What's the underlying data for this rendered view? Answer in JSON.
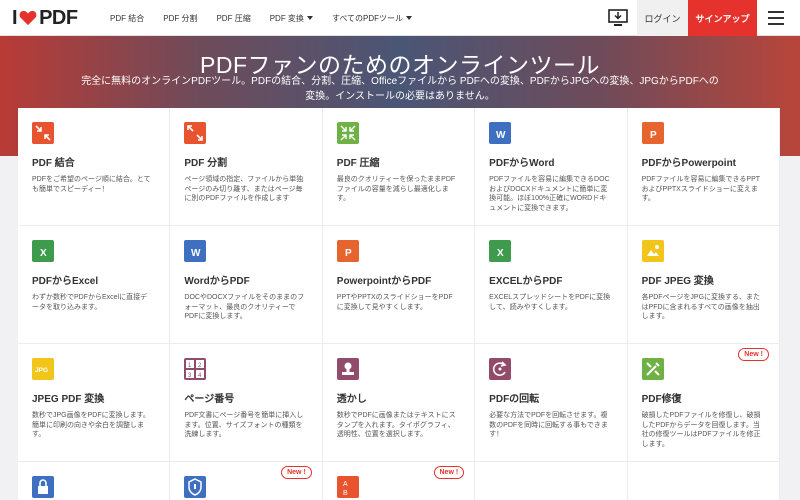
{
  "header": {
    "logo_left": "I",
    "logo_right": "PDF",
    "nav": [
      {
        "label": "PDF 結合"
      },
      {
        "label": "PDF 分割"
      },
      {
        "label": "PDF 圧縮"
      },
      {
        "label": "PDF 変換",
        "dropdown": true
      },
      {
        "label": "すべてのPDFツール",
        "dropdown": true
      }
    ],
    "login": "ログイン",
    "signup": "サインアップ"
  },
  "hero": {
    "title": "PDFファンのためのオンラインツール",
    "subtitle": "完全に無料のオンラインPDFツール。PDFの結合、分割、圧縮、Officeファイルから PDFへの変換、PDFからJPGへの変換、JPGからPDFへの変換。インストールの必要はありません。"
  },
  "tools": [
    {
      "title": "PDF 結合",
      "desc": "PDFをご希望のページ順に結合。とても簡単でスピーディー！",
      "icon": "merge-icon",
      "color": "#e8542f"
    },
    {
      "title": "PDF 分割",
      "desc": "ページ領域の指定、ファイルから単独ページのみ切り離す、またはページ毎に別のPDFファイルを作成します",
      "icon": "split-icon",
      "color": "#e8542f"
    },
    {
      "title": "PDF 圧縮",
      "desc": "最良のクオリティーを保ったままPDFファイルの容量を減らし最適化します。",
      "icon": "compress-icon",
      "color": "#6fb145"
    },
    {
      "title": "PDFからWord",
      "desc": "PDFファイルを容易に編集できるDOCおよびDOCXドキュメントに簡単に変換可能。ほぼ100%正確にWORDドキュメントに変換できます。",
      "icon": "word-icon",
      "color": "#3f6fc0"
    },
    {
      "title": "PDFからPowerpoint",
      "desc": "PDFファイルを容易に編集できるPPTおよびPPTXスライドショーに変えます。",
      "icon": "powerpoint-icon",
      "color": "#e8642f"
    },
    {
      "title": "PDFからExcel",
      "desc": "わずか数秒でPDFからExcelに直接データを取り込みます。",
      "icon": "excel-icon",
      "color": "#3e9a4d"
    },
    {
      "title": "WordからPDF",
      "desc": "DOCやDOCXファイルをそのままのフォーマット、最良のクオリティーでPDFに変換します。",
      "icon": "word-to-pdf-icon",
      "color": "#3f6fc0"
    },
    {
      "title": "PowerpointからPDF",
      "desc": "PPTやPPTXのスライドショーをPDFに変換して見やすくします。",
      "icon": "powerpoint-to-pdf-icon",
      "color": "#e8642f"
    },
    {
      "title": "EXCELからPDF",
      "desc": "EXCELスプレッドシートをPDFに変換して、読みやすくします。",
      "icon": "excel-to-pdf-icon",
      "color": "#3e9a4d"
    },
    {
      "title": "PDF JPEG 変換",
      "desc": "各PDFページをJPGに変換する、またはPFDに含まれるすべての画像を抽出します。",
      "icon": "pdf-to-jpg-icon",
      "color": "#f2c51a"
    },
    {
      "title": "JPEG PDF 変換",
      "desc": "数秒でJPG画像をPDFに変換します。簡単に印刷の向きや余白を調整します。",
      "icon": "jpg-to-pdf-icon",
      "color": "#f2c51a",
      "icon_text": "JPG"
    },
    {
      "title": "ページ番号",
      "desc": "PDF文書にページ番号を簡単に挿入します。位置、サイズフォントの種類を洗練します。",
      "icon": "page-numbers-icon",
      "color": "#914b6b"
    },
    {
      "title": "透かし",
      "desc": "数秒でPDFに画像またはテキストにスタンプを入れます。タイポグラフィ、透明性、位置を選択します。",
      "icon": "watermark-icon",
      "color": "#914b6b"
    },
    {
      "title": "PDFの回転",
      "desc": "必要な方法でPDFを回転させます。複数のPDFを同時に回転する事もできます！",
      "icon": "rotate-icon",
      "color": "#914b6b"
    },
    {
      "title": "PDF修復",
      "desc": "破損したPDFファイルを修復し、破損したPDFからデータを回復します。当社の修復ツールはPDFファイルを修正します。",
      "icon": "repair-icon",
      "color": "#6fb145",
      "badge": "New !"
    },
    {
      "title": "",
      "desc": "",
      "icon": "lock-icon",
      "color": "#3f6fc0"
    },
    {
      "title": "",
      "desc": "",
      "icon": "shield-icon",
      "color": "#3f6fc0",
      "badge": "New !"
    },
    {
      "title": "",
      "desc": "",
      "icon": "organize-icon",
      "color": "#e8542f",
      "badge": "New !"
    },
    {
      "title": "",
      "desc": "",
      "icon": "",
      "color": ""
    },
    {
      "title": "",
      "desc": "",
      "icon": "",
      "color": ""
    }
  ]
}
